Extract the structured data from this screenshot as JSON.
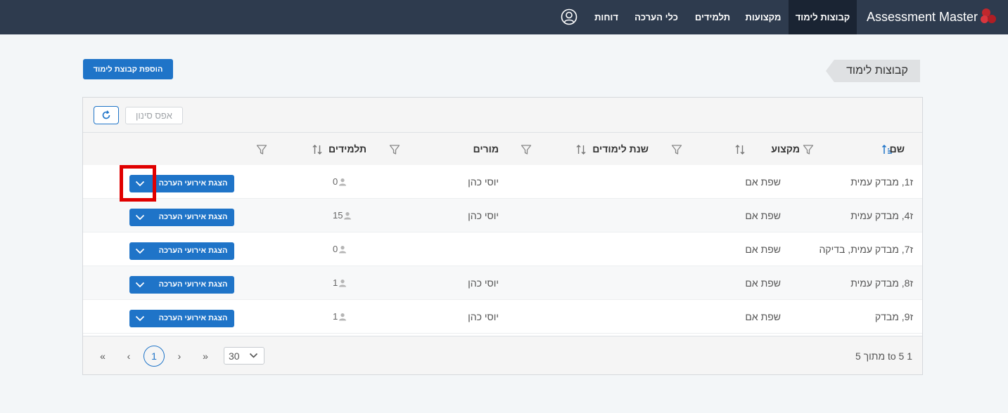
{
  "app": {
    "title": "Assessment Master"
  },
  "nav": {
    "items": [
      {
        "label": "קבוצות לימוד",
        "active": true
      },
      {
        "label": "מקצועות"
      },
      {
        "label": "תלמידים"
      },
      {
        "label": "כלי הערכה"
      },
      {
        "label": "דוחות"
      }
    ],
    "user_icon": "user-circle-icon"
  },
  "page": {
    "title": "קבוצות לימוד",
    "add_button": "הוספת קבוצת לימוד"
  },
  "toolbar": {
    "reset_filter": "אפס סינון",
    "refresh_icon": "refresh-icon"
  },
  "columns": {
    "name": "שם",
    "subject": "מקצוע",
    "school_year": "שנת לימודים",
    "teachers": "מורים",
    "students": "תלמידים"
  },
  "rows": [
    {
      "name": "ז1, מבדק עמית",
      "subject": "שפת אם",
      "school_year": "",
      "teachers": "יוסי כהן",
      "students": "0",
      "action": "הצגת אירועי הערכה"
    },
    {
      "name": "ז4, מבדק עמית",
      "subject": "שפת אם",
      "school_year": "",
      "teachers": "יוסי כהן",
      "students": "15",
      "action": "הצגת אירועי הערכה"
    },
    {
      "name": "ז7, מבדק עמית, בדיקה",
      "subject": "שפת אם",
      "school_year": "",
      "teachers": "",
      "students": "0",
      "action": "הצגת אירועי הערכה"
    },
    {
      "name": "ז8, מבדק עמית",
      "subject": "שפת אם",
      "school_year": "",
      "teachers": "יוסי כהן",
      "students": "1",
      "action": "הצגת אירועי הערכה"
    },
    {
      "name": "ז9, מבדק",
      "subject": "שפת אם",
      "school_year": "",
      "teachers": "יוסי כהן",
      "students": "1",
      "action": "הצגת אירועי הערכה"
    }
  ],
  "pagination": {
    "first": "«",
    "prev": "‹",
    "current_page": "1",
    "next": "›",
    "last": "»",
    "page_size": "30",
    "range_text": "1 to 5 מתוך 5"
  },
  "colors": {
    "nav_bg": "#2e3b4e",
    "nav_active": "#1a2433",
    "primary": "#1f74c8",
    "highlight": "#e00000"
  }
}
